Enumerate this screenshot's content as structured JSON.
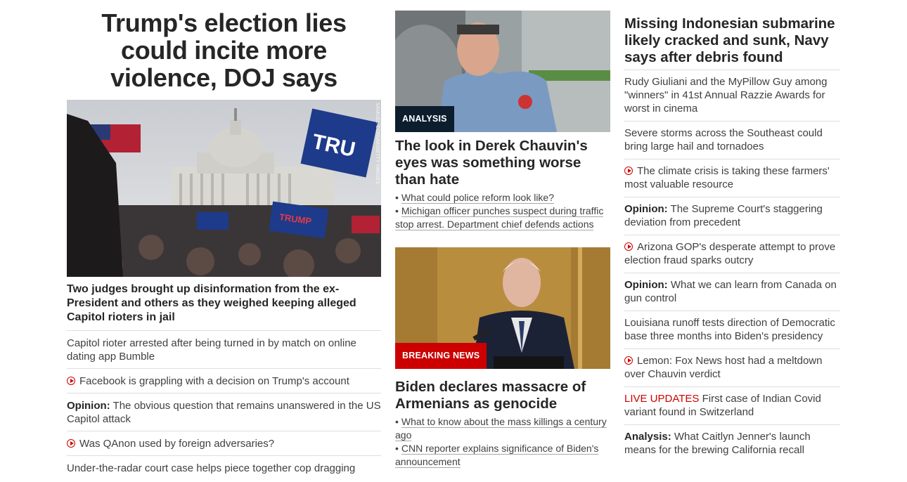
{
  "left": {
    "hero_title": "Trump's election lies could incite more violence, DOJ says",
    "photo_credit": "SAMUEL CORUM/GETTY IMAGES",
    "lead_headline": "Two judges brought up disinformation from the ex-President and others as they weighed keeping alleged Capitol rioters in jail",
    "items": [
      {
        "prefix": "",
        "text": "Capitol rioter arrested after being turned in by match on online dating app Bumble",
        "video": false
      },
      {
        "prefix": "",
        "text": "Facebook is grappling with a decision on Trump's account",
        "video": true
      },
      {
        "prefix": "Opinion:",
        "text": " The obvious question that remains unanswered in the US Capitol attack",
        "video": false
      },
      {
        "prefix": "",
        "text": "Was QAnon used by foreign adversaries?",
        "video": true
      },
      {
        "prefix": "",
        "text": "Under-the-radar court case helps piece together cop dragging",
        "video": false
      }
    ]
  },
  "middle": {
    "story1": {
      "tag": "ANALYSIS",
      "headline": "The look in Derek Chauvin's eyes was something worse than hate",
      "links": [
        "What could police reform look like?",
        "Michigan officer punches suspect during traffic stop arrest. Department chief defends actions"
      ]
    },
    "story2": {
      "tag": "BREAKING NEWS",
      "headline": "Biden declares massacre of Armenians as genocide",
      "links": [
        "What to know about the mass killings a century ago",
        "CNN reporter explains significance of Biden's announcement"
      ]
    }
  },
  "right": {
    "top_headline": "Missing Indonesian submarine likely cracked and sunk, Navy says after debris found",
    "items": [
      {
        "prefix": "",
        "text": "Rudy Giuliani and the MyPillow Guy among \"winners\" in 41st Annual Razzie Awards for worst in cinema",
        "video": false,
        "live": ""
      },
      {
        "prefix": "",
        "text": "Severe storms across the Southeast could bring large hail and tornadoes",
        "video": false,
        "live": ""
      },
      {
        "prefix": "",
        "text": "The climate crisis is taking these farmers' most valuable resource",
        "video": true,
        "live": ""
      },
      {
        "prefix": "Opinion:",
        "text": " The Supreme Court's staggering deviation from precedent",
        "video": false,
        "live": ""
      },
      {
        "prefix": "",
        "text": "Arizona GOP's desperate attempt to prove election fraud sparks outcry",
        "video": true,
        "live": ""
      },
      {
        "prefix": "Opinion:",
        "text": " What we can learn from Canada on gun control",
        "video": false,
        "live": ""
      },
      {
        "prefix": "",
        "text": "Louisiana runoff tests direction of Democratic base three months into Biden's presidency",
        "video": false,
        "live": ""
      },
      {
        "prefix": "",
        "text": "Lemon: Fox News host had a meltdown over Chauvin verdict",
        "video": true,
        "live": ""
      },
      {
        "prefix": "",
        "text": " First case of Indian Covid variant found in Switzerland",
        "video": false,
        "live": "LIVE UPDATES"
      },
      {
        "prefix": "Analysis:",
        "text": " What Caitlyn Jenner's launch means for the brewing California recall",
        "video": false,
        "live": ""
      }
    ]
  },
  "colors": {
    "accent_red": "#cc0000",
    "analysis_tag": "#0c1d2e",
    "text": "#262626"
  },
  "icons": {
    "video": "play-circle-icon"
  }
}
